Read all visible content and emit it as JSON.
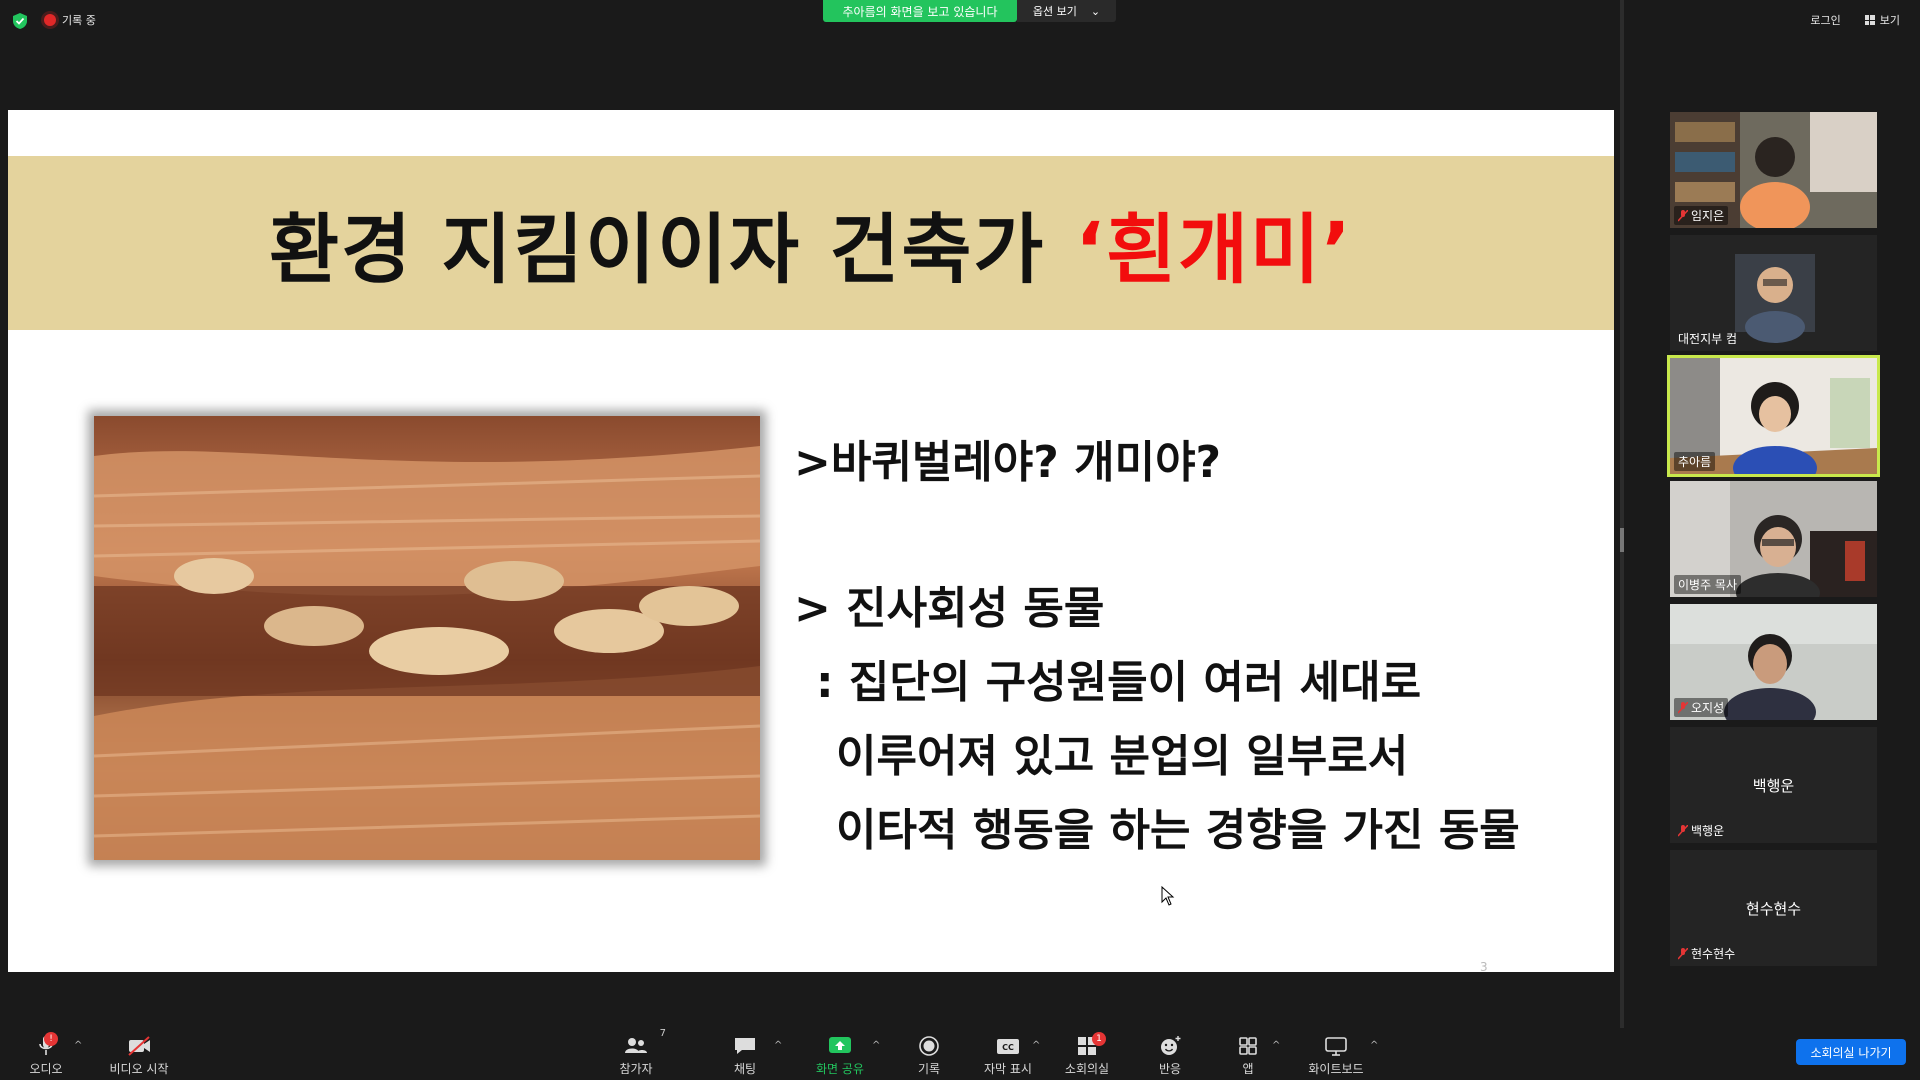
{
  "topbar": {
    "recording_label": "기록 중",
    "viewing_banner": "추아름의 화면을 보고 있습니다",
    "view_options_label": "옵션 보기",
    "login_label": "로그인",
    "view_label": "보기"
  },
  "slide": {
    "title_main": "환경 지킴이이자 건축가",
    "title_accent": "‘흰개미’",
    "bullet1": ">바퀴벌레야? 개미야?",
    "bullet2": "> 진사회성 동물",
    "definition_lines": [
      ": 집단의 구성원들이 여러 세대로",
      "이루어져 있고 분업의 일부로서",
      "이타적 행동을 하는 경향을 가진 동물"
    ],
    "page_number": "3",
    "colors": {
      "title_band": "#e4d39d",
      "accent": "#f20d0d"
    }
  },
  "participants": [
    {
      "name": "임지은",
      "muted": true,
      "video": true
    },
    {
      "name": "대전지부 컴",
      "muted": false,
      "video": true
    },
    {
      "name": "추아름",
      "muted": false,
      "video": true,
      "active": true
    },
    {
      "name": "이병주 목사",
      "muted": false,
      "video": true
    },
    {
      "name": "오지성",
      "muted": true,
      "video": true
    },
    {
      "name": "백행운",
      "muted": true,
      "video": false
    },
    {
      "name": "현수현수",
      "muted": true,
      "video": false
    }
  ],
  "toolbar": {
    "audio": "오디오",
    "video": "비디오 시작",
    "participants": "참가자",
    "participants_count": "7",
    "chat": "채팅",
    "share": "화면 공유",
    "record": "기록",
    "captions": "자막 표시",
    "breakout": "소회의실",
    "breakout_badge": "1",
    "reactions": "반응",
    "apps": "앱",
    "whiteboard": "화이트보드",
    "leave_breakout": "소회의실 나가기",
    "audio_badge": "!"
  }
}
